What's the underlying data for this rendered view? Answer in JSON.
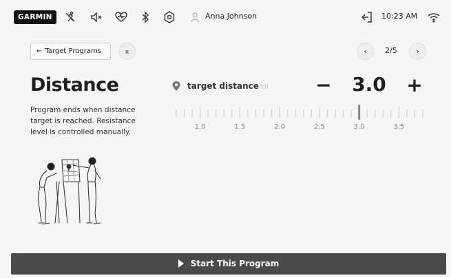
{
  "status_bar": {
    "brand": "GARMIN",
    "user_name": "Anna Johnson",
    "time": "10:23 AM",
    "icons": [
      "no-run-icon",
      "volume-icon",
      "heart-icon",
      "bluetooth-icon",
      "settings-icon",
      "user-icon",
      "exit-icon",
      "wifi-icon"
    ]
  },
  "nav": {
    "back_label": "Target Programs",
    "page_indicator": "2/5"
  },
  "program": {
    "title": "Distance",
    "description": "Program ends when distance target is reached. Resistance level is controlled manually."
  },
  "target": {
    "label": "target distance",
    "unit": "mi",
    "value": "3.0",
    "minus": "−",
    "plus": "+"
  },
  "ruler": {
    "tick_labels": [
      "1.0",
      "1.5",
      "2.0",
      "2.5",
      "3.0",
      "3.5"
    ],
    "min": 0.7,
    "max": 3.8,
    "step": 0.1,
    "selected": 3.0
  },
  "start": {
    "label": "Start This Program"
  },
  "colors": {
    "background": "#f5f5f5",
    "start_bar": "#4a4a4a",
    "ruler_selected": "#888888",
    "ruler_tick": "#cccccc"
  }
}
